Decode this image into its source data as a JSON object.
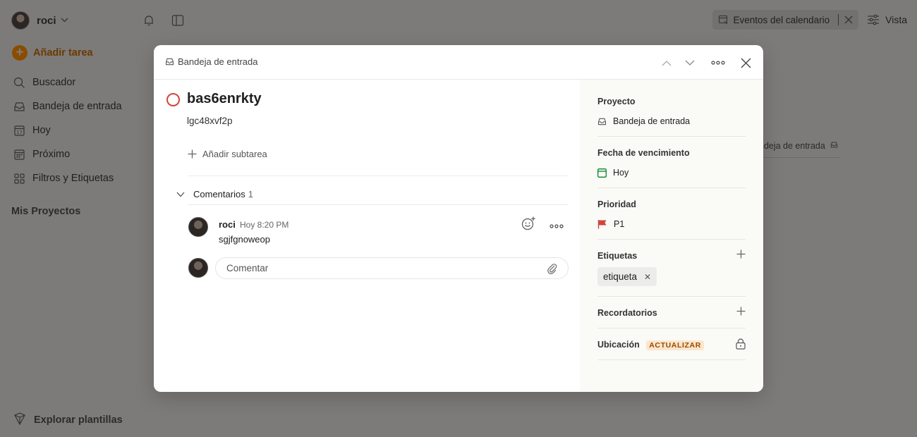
{
  "user": {
    "name": "roci"
  },
  "sidebar": {
    "add_task": "Añadir tarea",
    "items": [
      {
        "label": "Buscador",
        "icon": "search-icon"
      },
      {
        "label": "Bandeja de entrada",
        "icon": "inbox-icon"
      },
      {
        "label": "Hoy",
        "icon": "calendar-today-icon"
      },
      {
        "label": "Próximo",
        "icon": "calendar-grid-icon"
      },
      {
        "label": "Filtros y Etiquetas",
        "icon": "grid-icon"
      }
    ],
    "projects_heading": "Mis Proyectos",
    "templates": "Explorar plantillas"
  },
  "topbar": {
    "calendar_events": "Eventos del calendario",
    "view": "Vista"
  },
  "background": {
    "inbox_label": "ndeja de entrada"
  },
  "modal": {
    "breadcrumb": "Bandeja de entrada",
    "task": {
      "title": "bas6enrkty",
      "description": "lgc48xvf2p",
      "add_subtask": "Añadir subtarea"
    },
    "comments": {
      "label": "Comentarios",
      "count": "1",
      "items": [
        {
          "author": "roci",
          "time": "Hoy 8:20 PM",
          "text": "sgjfgnoweop"
        }
      ],
      "input_placeholder": "Comentar"
    },
    "details": {
      "project_label": "Proyecto",
      "project_value": "Bandeja de entrada",
      "due_label": "Fecha de vencimiento",
      "due_value": "Hoy",
      "priority_label": "Prioridad",
      "priority_value": "P1",
      "labels_label": "Etiquetas",
      "labels": [
        "etiqueta"
      ],
      "reminders_label": "Recordatorios",
      "location_label": "Ubicación",
      "location_badge": "ACTUALIZAR"
    }
  },
  "colors": {
    "accent": "#d1453b",
    "due_green": "#058527",
    "priority_red": "#d1453b",
    "upgrade_bg": "#fbe6cc",
    "upgrade_text": "#9a4a00"
  }
}
